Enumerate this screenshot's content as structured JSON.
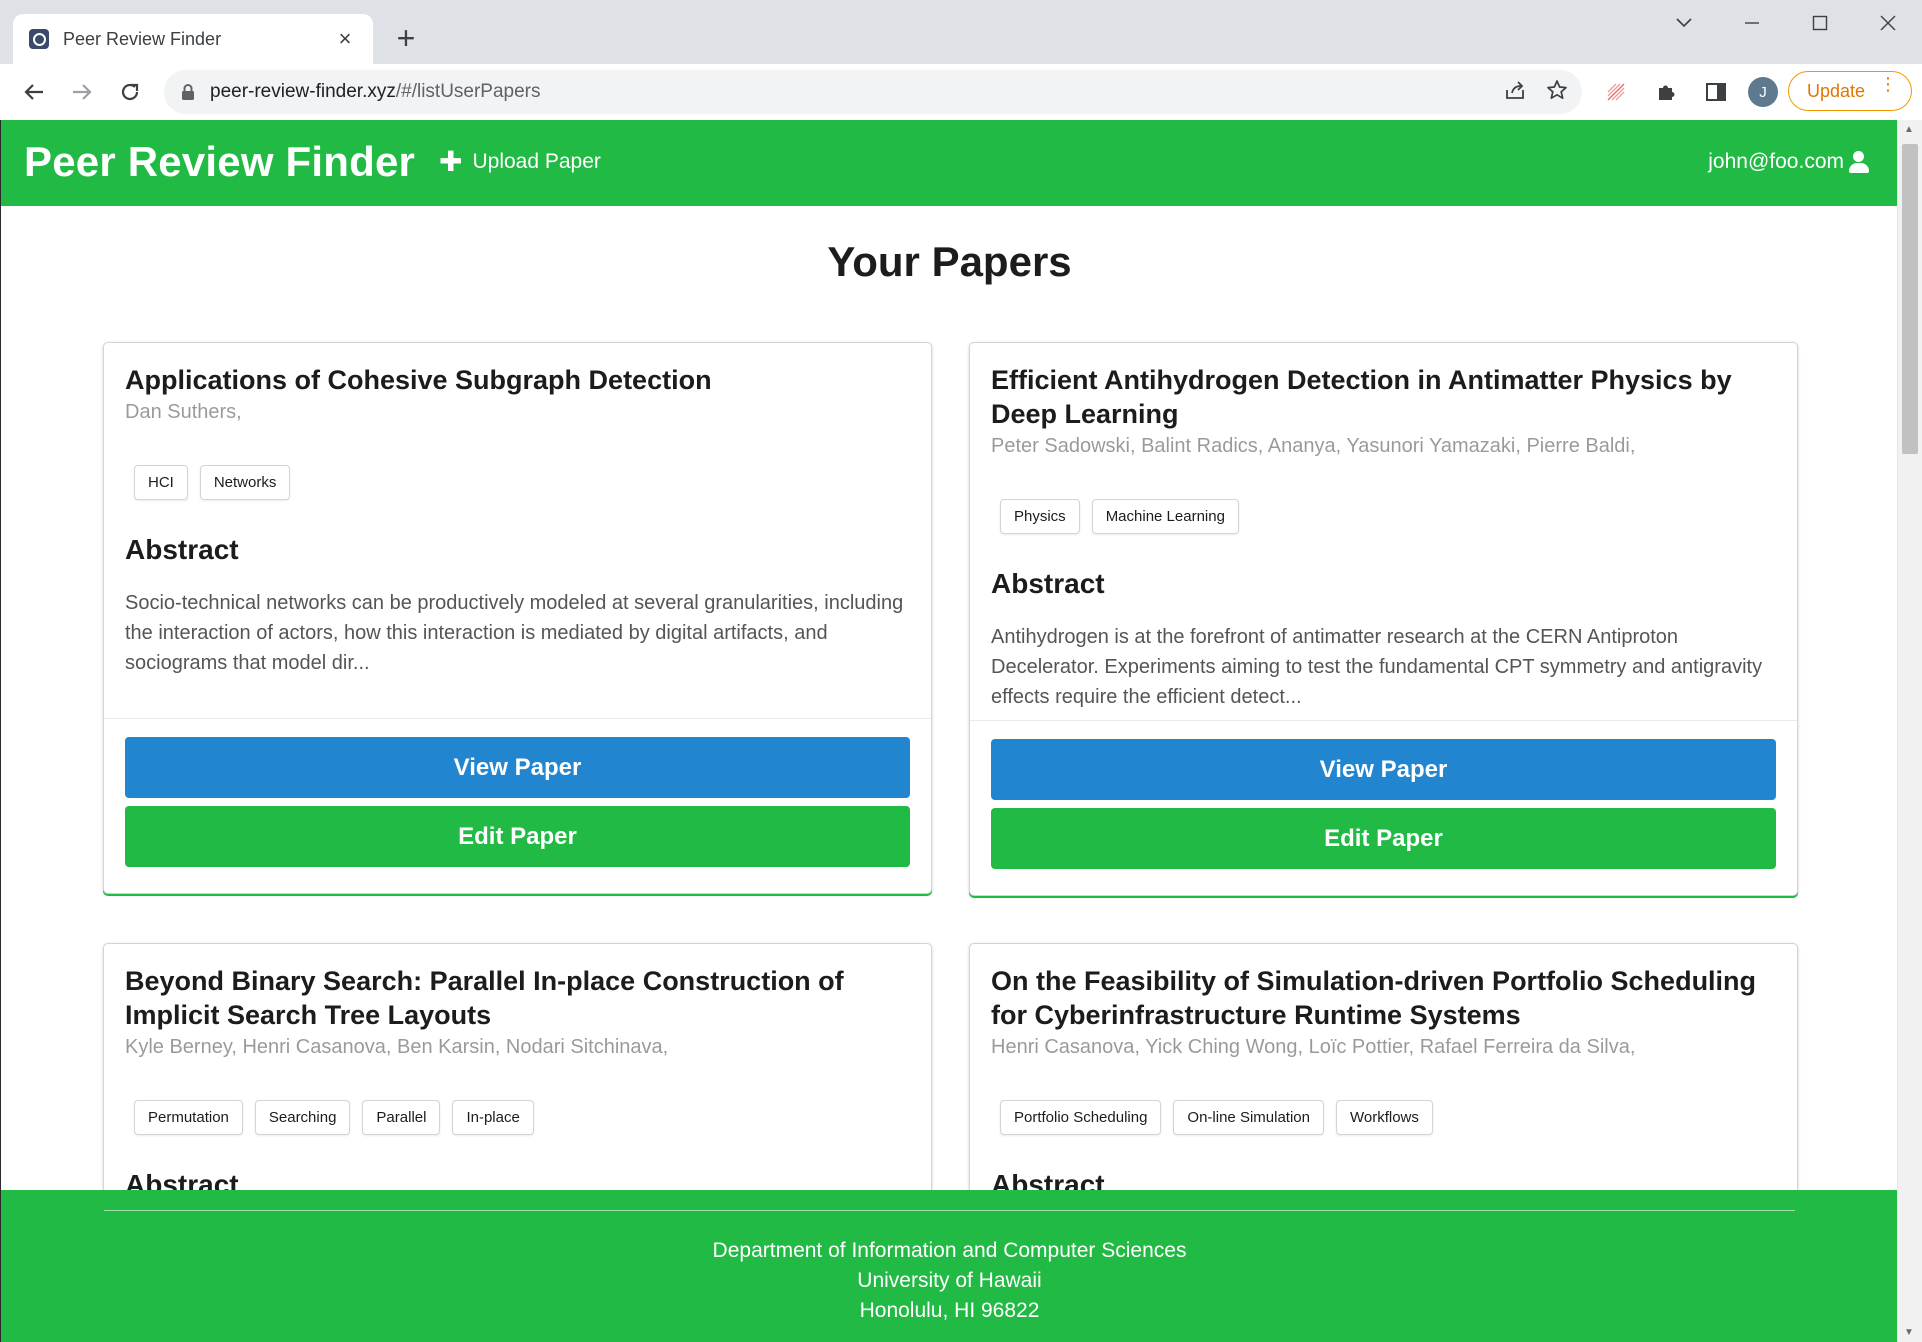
{
  "browser": {
    "tab_title": "Peer Review Finder",
    "tab_close": "×",
    "new_tab": "+",
    "url_host": "peer-review-finder.xyz",
    "url_path": "/#/listUserPapers",
    "profile_initial": "J",
    "update_label": "Update"
  },
  "nav": {
    "brand": "Peer Review Finder",
    "upload_label": "Upload Paper",
    "user_email": "john@foo.com"
  },
  "page": {
    "title": "Your Papers"
  },
  "papers": [
    {
      "title": "Applications of Cohesive Subgraph Detection",
      "authors": "Dan Suthers,",
      "tags": [
        "HCI",
        "Networks"
      ],
      "abstract_heading": "Abstract",
      "abstract": "Socio-technical networks can be productively modeled at several granularities, including the interaction of actors, how this interaction is mediated by digital artifacts, and sociograms that model dir...",
      "view_label": "View Paper",
      "edit_label": "Edit Paper"
    },
    {
      "title": "Efficient Antihydrogen Detection in Antimatter Physics by Deep Learning",
      "authors": "Peter Sadowski, Balint Radics, Ananya, Yasunori Yamazaki, Pierre Baldi,",
      "tags": [
        "Physics",
        "Machine Learning"
      ],
      "abstract_heading": "Abstract",
      "abstract": "Antihydrogen is at the forefront of antimatter research at the CERN Antiproton Decelerator. Experiments aiming to test the fundamental CPT symmetry and antigravity effects require the efficient detect...",
      "view_label": "View Paper",
      "edit_label": "Edit Paper"
    },
    {
      "title": "Beyond Binary Search: Parallel In-place Construction of Implicit Search Tree Layouts",
      "authors": "Kyle Berney, Henri Casanova, Ben Karsin, Nodari Sitchinava,",
      "tags": [
        "Permutation",
        "Searching",
        "Parallel",
        "In-place"
      ],
      "abstract_heading": "Abstract"
    },
    {
      "title": "On the Feasibility of Simulation-driven Portfolio Scheduling for Cyberinfrastructure Runtime Systems",
      "authors": "Henri Casanova, Yick Ching Wong, Loïc Pottier, Rafael Ferreira da Silva,",
      "tags": [
        "Portfolio Scheduling",
        "On-line Simulation",
        "Workflows"
      ],
      "abstract_heading": "Abstract"
    }
  ],
  "footer": {
    "line1": "Department of Information and Computer Sciences",
    "line2": "University of Hawaii",
    "line3": "Honolulu, HI 96822"
  },
  "colors": {
    "primary_green": "#21ba45",
    "view_blue": "#2185d0",
    "update_orange": "#e37400"
  }
}
